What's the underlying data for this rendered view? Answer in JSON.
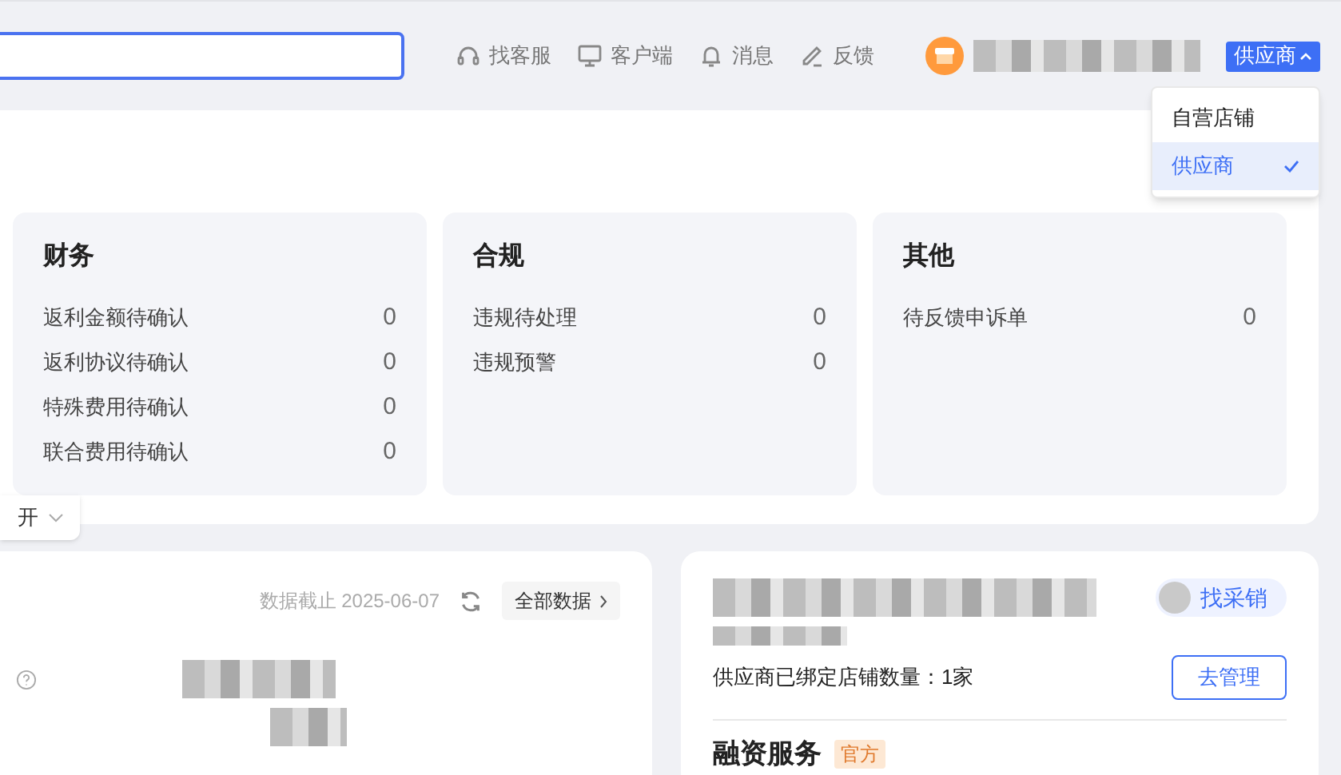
{
  "header": {
    "actions": [
      {
        "kind": "headset",
        "label": "找客服"
      },
      {
        "kind": "monitor",
        "label": "客户端"
      },
      {
        "kind": "bell",
        "label": "消息"
      },
      {
        "kind": "pen",
        "label": "反馈"
      }
    ],
    "role_button": {
      "label": "供应商"
    },
    "role_menu": [
      {
        "label": "自营店铺",
        "selected": false
      },
      {
        "label": "供应商",
        "selected": true
      }
    ]
  },
  "todo_groups": [
    {
      "title": "财务",
      "items": [
        {
          "label": "返利金额待确认",
          "count": "0"
        },
        {
          "label": "返利协议待确认",
          "count": "0"
        },
        {
          "label": "特殊费用待确认",
          "count": "0"
        },
        {
          "label": "联合费用待确认",
          "count": "0"
        }
      ]
    },
    {
      "title": "合规",
      "items": [
        {
          "label": "违规待处理",
          "count": "0"
        },
        {
          "label": "违规预警",
          "count": "0"
        }
      ]
    },
    {
      "title": "其他",
      "items": [
        {
          "label": "待反馈申诉单",
          "count": "0"
        }
      ]
    }
  ],
  "expand_toggle": {
    "label": "开"
  },
  "data_card": {
    "as_of": "数据截止 2025-06-07",
    "all_data_button": "全部数据"
  },
  "supplier_card": {
    "contact_button": "找采销",
    "bound_shops": "供应商已绑定店铺数量：1家",
    "manage_button": "去管理",
    "finance_title": "融资服务",
    "finance_badge": "官方"
  }
}
